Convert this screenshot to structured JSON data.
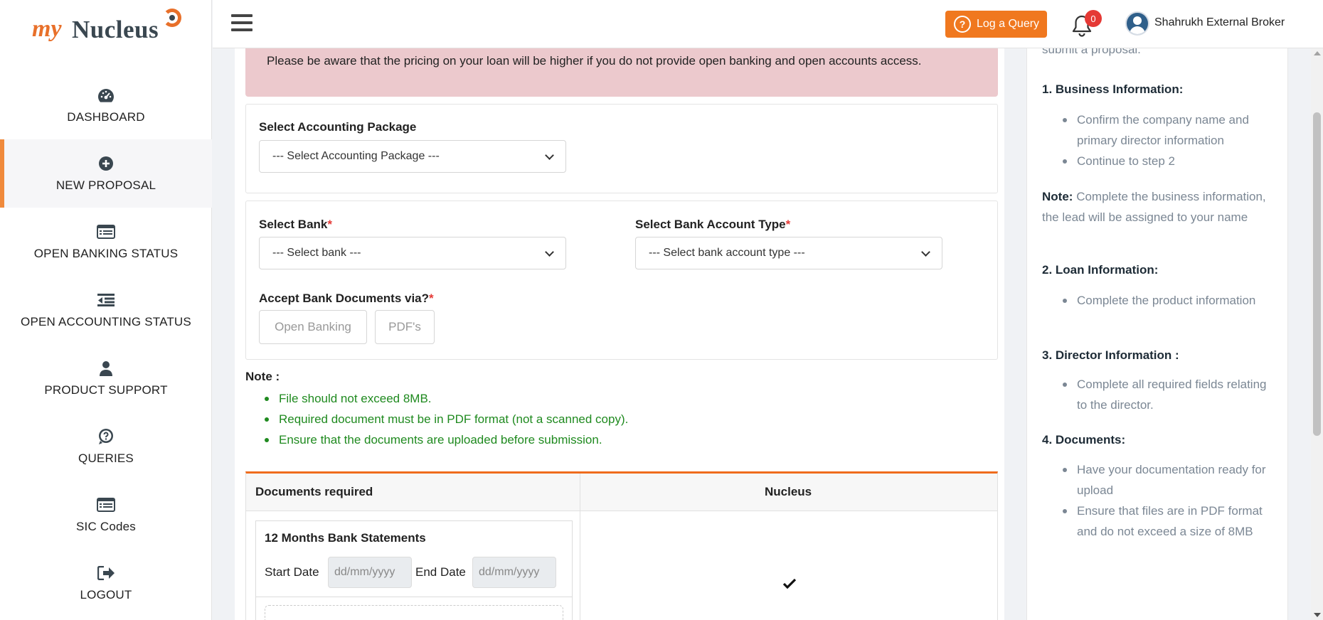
{
  "brand": {
    "logo_prefix": "my",
    "logo_main": "Nucleus",
    "accent": "#f0781f"
  },
  "sidebar": {
    "items": [
      {
        "label": "DASHBOARD",
        "icon": "dashboard-gauge-icon",
        "active": false
      },
      {
        "label": "NEW PROPOSAL",
        "icon": "plus-circle-icon",
        "active": true
      },
      {
        "label": "OPEN BANKING STATUS",
        "icon": "list-card-icon",
        "active": false
      },
      {
        "label": "OPEN ACCOUNTING STATUS",
        "icon": "outdent-list-icon",
        "active": false
      },
      {
        "label": "PRODUCT SUPPORT",
        "icon": "user-icon",
        "active": false
      },
      {
        "label": "QUERIES",
        "icon": "question-chat-icon",
        "active": false
      },
      {
        "label": "SIC Codes",
        "icon": "list-card-icon",
        "active": false
      },
      {
        "label": "LOGOUT",
        "icon": "logout-icon",
        "active": false
      }
    ]
  },
  "topbar": {
    "log_query_label": "Log a Query",
    "notification_count": "0",
    "user_name": "Shahrukh External Broker"
  },
  "alert": {
    "text": "Please be aware that the pricing on your loan will be higher if you do not provide open banking and open accounts access."
  },
  "accounting": {
    "label": "Select Accounting Package",
    "selected": "--- Select Accounting Package ---"
  },
  "bank": {
    "bank_label": "Select Bank",
    "bank_selected": "--- Select bank ---",
    "type_label": "Select Bank Account Type",
    "type_selected": "--- Select bank account type ---",
    "required_mark": "*",
    "accept_label": "Accept Bank Documents via?",
    "options": [
      "Open Banking",
      "PDF's"
    ]
  },
  "note": {
    "title": "Note :",
    "items": [
      "File should not exceed 8MB.",
      "Required document must be in PDF format (not a scanned copy).",
      "Ensure that the documents are uploaded before submission."
    ]
  },
  "documents": {
    "col1": "Documents required",
    "col2": "Nucleus",
    "row_title": "12 Months Bank Statements",
    "start_label": "Start Date",
    "end_label": "End Date",
    "date_placeholder": "dd/mm/yyyy"
  },
  "guide": {
    "cut_text": "submit a proposal.",
    "sections": [
      {
        "heading": "1. Business Information:",
        "items": [
          "Confirm the company name and primary director information",
          "Continue to step 2"
        ]
      },
      {
        "heading": "2. Loan Information:",
        "items": [
          "Complete the product information"
        ]
      },
      {
        "heading": "3. Director Information :",
        "items": [
          "Complete all required fields relating to the director."
        ]
      },
      {
        "heading": "4. Documents:",
        "items": [
          "Have your documentation ready for upload",
          "Ensure that files are in PDF format and do not exceed a size of 8MB"
        ]
      }
    ],
    "note_label": "Note:",
    "note_text": "Complete the business information, the lead will be assigned to your name"
  }
}
